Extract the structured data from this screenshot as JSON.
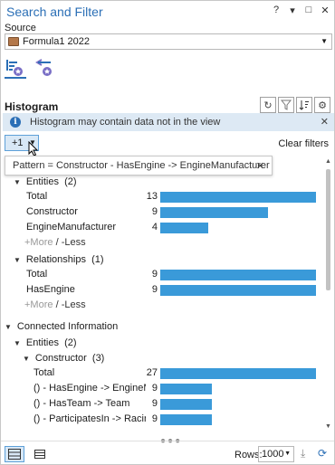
{
  "window": {
    "title": "Search and Filter",
    "controls": [
      "?",
      "▾",
      "□",
      "✕"
    ]
  },
  "source": {
    "label": "Source",
    "value": "Formula1 2022"
  },
  "histogram": {
    "title": "Histogram",
    "tools": [
      "refresh-icon",
      "filter-icon",
      "sort-icon",
      "settings-icon"
    ]
  },
  "info_bar": {
    "text": "Histogram may contain data not in the view"
  },
  "filter": {
    "chip_label": "+1",
    "clear_label": "Clear filters",
    "tooltip_text": "Pattern = Constructor - HasEngine -> EngineManufacturer"
  },
  "sections": {
    "entities1": {
      "title": "Entities",
      "count": "(2)",
      "rows": [
        {
          "label": "Total",
          "count": "13",
          "value": 13
        },
        {
          "label": "Constructor",
          "count": "9",
          "value": 9
        },
        {
          "label": "EngineManufacturer",
          "count": "4",
          "value": 4
        }
      ],
      "more": "+More",
      "less": "-Less"
    },
    "relationships": {
      "title": "Relationships",
      "count": "(1)",
      "rows": [
        {
          "label": "Total",
          "count": "9",
          "value": 9
        },
        {
          "label": "HasEngine",
          "count": "9",
          "value": 9
        }
      ],
      "more": "+More",
      "less": "-Less"
    },
    "connected": {
      "title": "Connected Information",
      "entities_title": "Entities",
      "entities_count": "(2)",
      "constructor_title": "Constructor",
      "constructor_count": "(3)",
      "rows": [
        {
          "label": "Total",
          "count": "27",
          "value": 27
        },
        {
          "label": "() - HasEngine -> EngineMa...",
          "count": "9",
          "value": 9
        },
        {
          "label": "() - HasTeam -> Team",
          "count": "9",
          "value": 9
        },
        {
          "label": "() - ParticipatesIn -> Racing...",
          "count": "9",
          "value": 9
        }
      ]
    }
  },
  "footer": {
    "rows_label": "Rows:",
    "rows_value": "1000"
  },
  "colors": {
    "bar": "#3a9ad9",
    "accent": "#2b6fb6",
    "info_bg": "#dde9f4"
  }
}
